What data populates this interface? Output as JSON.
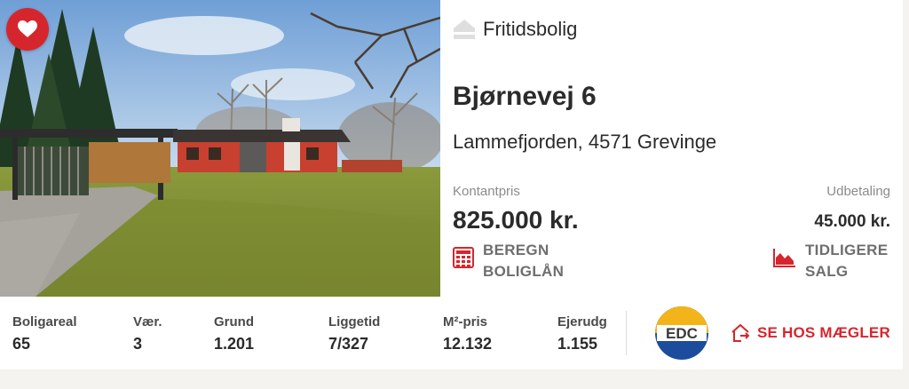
{
  "listing": {
    "favorite_icon": "heart-icon",
    "property_type": "Fritidsbolig",
    "property_type_icon": "house-icon",
    "title": "Bjørnevej 6",
    "address": "Lammefjorden, 4571 Grevinge",
    "price_label": "Kontantpris",
    "price": "825.000 kr.",
    "payout_label": "Udbetaling",
    "payout": "45.000 kr.",
    "calc_action": {
      "line1": "BEREGN",
      "line2": "BOLIGLÅN",
      "icon": "calculator-icon"
    },
    "sales_action": {
      "line1": "TIDLIGERE",
      "line2": "SALG",
      "icon": "area-chart-icon"
    }
  },
  "stats": [
    {
      "label": "Boligareal",
      "value": "65"
    },
    {
      "label": "Vær.",
      "value": "3"
    },
    {
      "label": "Grund",
      "value": "1.201"
    },
    {
      "label": "Liggetid",
      "value": "7/327"
    },
    {
      "label": "M²-pris",
      "value": "12.132"
    },
    {
      "label": "Ejerudg",
      "value": "1.155"
    }
  ],
  "agent": {
    "logo_text": "EDC",
    "cta_label": "SE HOS MÆGLER",
    "cta_icon": "house-arrow-icon"
  },
  "colors": {
    "accent": "#d6262d",
    "edc_yellow": "#f2b418",
    "edc_blue": "#1c4c9c"
  }
}
